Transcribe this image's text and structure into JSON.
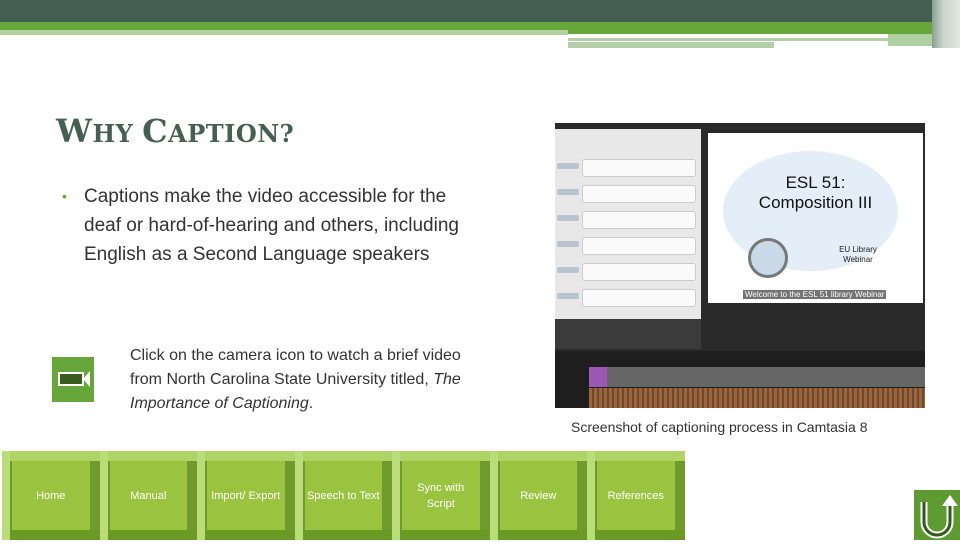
{
  "slide": {
    "title_first": "W",
    "title_rest1": "HY ",
    "title_c": "C",
    "title_rest2": "APTION?",
    "bullet": "Captions make the video accessible for the deaf or hard-of-hearing and others, including English as a Second Language speakers",
    "camera_text_before": "Click on the camera icon to watch a brief video from North Carolina State University titled, ",
    "camera_text_italic": "The Importance of Captioning",
    "camera_text_after": ".",
    "screenshot_caption": "Screenshot of captioning process  in Camtasia 8"
  },
  "screenshot": {
    "heading1": "ESL 51:",
    "heading2": "Composition III",
    "sub1": "EU Library",
    "sub2": "Webinar",
    "caption_overlay": "Welcome to the ESL 51 library Webinar"
  },
  "nav": [
    {
      "label": "Home"
    },
    {
      "label": "Manual"
    },
    {
      "label": "Import/ Export"
    },
    {
      "label": "Speech to Text"
    },
    {
      "label": "Sync with Script"
    },
    {
      "label": "Review"
    },
    {
      "label": "References"
    }
  ],
  "icons": {
    "camera": "video-camera-icon",
    "back": "u-turn-return-icon"
  },
  "colors": {
    "dark_green": "#455f52",
    "accent_green": "#67a63a",
    "button_green": "#9ac440"
  }
}
